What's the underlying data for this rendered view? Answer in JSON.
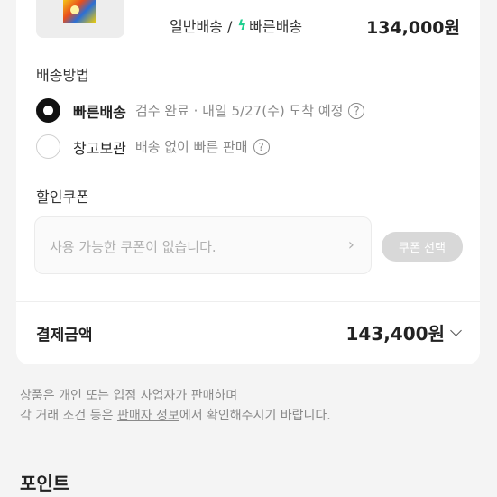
{
  "product": {
    "shipping_options_text": "일반배송 /",
    "fast_label": "빠른배송",
    "price": "134,000원"
  },
  "delivery": {
    "title": "배송방법",
    "options": [
      {
        "label": "빠른배송",
        "desc": "검수 완료 · 내일 5/27(수) 도착 예정",
        "selected": true
      },
      {
        "label": "창고보관",
        "desc": "배송 없이 빠른 판매",
        "selected": false
      }
    ],
    "help_glyph": "?"
  },
  "coupon": {
    "title": "할인쿠폰",
    "placeholder": "사용 가능한 쿠폰이 없습니다.",
    "button_label": "쿠폰 선택"
  },
  "payment": {
    "label": "결제금액",
    "amount": "143,400원"
  },
  "notice": {
    "line1": "상품은 개인 또는 입점 사업자가 판매하며",
    "line2_prefix": "각 거래 조건 등은 ",
    "line2_link": "판매자 정보",
    "line2_suffix": "에서 확인해주시기 바랍니다."
  },
  "points": {
    "title": "포인트"
  },
  "colors": {
    "accent_bolt": "#1fcf8f",
    "background": "#f4f4f4",
    "card": "#ffffff"
  }
}
